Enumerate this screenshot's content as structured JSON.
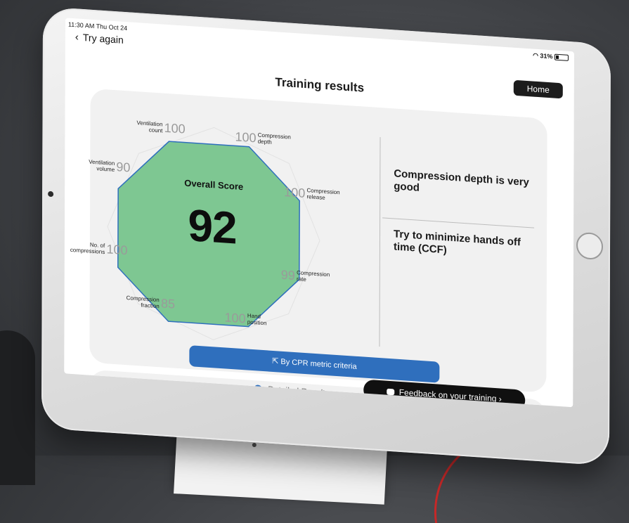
{
  "status": {
    "time": "11:30 AM  Thu Oct 24",
    "battery": "31%"
  },
  "nav": {
    "back_label": "Try again",
    "home_label": "Home"
  },
  "page": {
    "title": "Training results"
  },
  "score": {
    "label": "Overall Score",
    "value": "92",
    "polygon_color": "#7ec792",
    "polygon_stroke": "#2f6fbd"
  },
  "metrics": [
    {
      "name": "Ventilation count",
      "l1": "Ventilation",
      "l2": "count",
      "value": "100"
    },
    {
      "name": "Compression depth",
      "l1": "Compression",
      "l2": "depth",
      "value": "100"
    },
    {
      "name": "Compression release",
      "l1": "Compression",
      "l2": "release",
      "value": "100"
    },
    {
      "name": "Compression rate",
      "l1": "Compression",
      "l2": "rate",
      "value": "99"
    },
    {
      "name": "Hand position",
      "l1": "Hand",
      "l2": "position",
      "value": "100"
    },
    {
      "name": "Compression fraction",
      "l1": "Compression",
      "l2": "fraction",
      "value": "85"
    },
    {
      "name": "No. of compressions",
      "l1": "No. of",
      "l2": "compressions",
      "value": "100"
    },
    {
      "name": "Ventilation volume",
      "l1": "Ventilation",
      "l2": "volume",
      "value": "90"
    }
  ],
  "feedback": {
    "item1": "Compression depth is very good",
    "item2": "Try to minimize hands off time (CCF)"
  },
  "buttons": {
    "cpr_criteria": "By CPR metric criteria",
    "detailed": "Detailed Results",
    "feedback": "Feedback on your training",
    "feedback_arrow": "›",
    "external_icon": "⇱"
  },
  "colors": {
    "accent": "#2f6fbd",
    "score_fill": "#7ec792",
    "home_bg": "#1c1c1c"
  }
}
